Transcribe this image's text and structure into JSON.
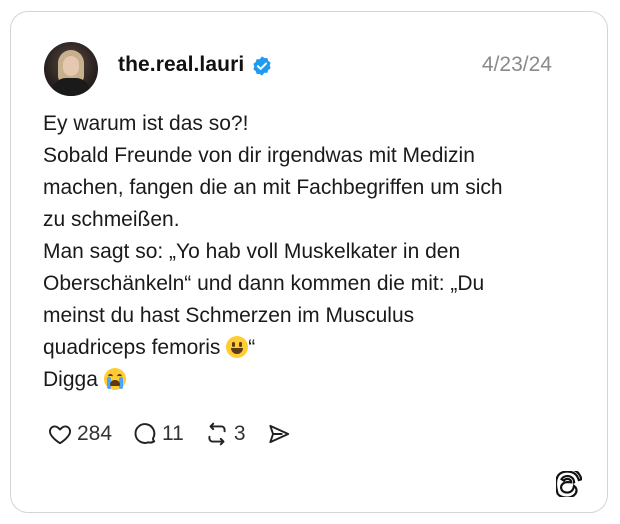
{
  "post": {
    "username": "the.real.lauri",
    "date": "4/23/24",
    "lines": [
      "Ey warum ist das so?!",
      "Sobald Freunde von dir irgendwas mit Medizin",
      "machen, fangen die an mit Fachbegriffen um sich",
      "zu schmeißen.",
      "Man sagt so: „Yo hab voll Muskelkater in den",
      "Oberschänkeln“ und dann kommen die mit: „Du",
      "meinst du hast Schmerzen im Musculus",
      "quadriceps femoris ",
      "Digga "
    ],
    "line7_suffix": "“"
  },
  "actions": {
    "likes": "284",
    "comments": "11",
    "reposts": "3"
  },
  "icons": {
    "verified": "verified-badge-icon",
    "like": "heart-icon",
    "comment": "comment-bubble-icon",
    "repost": "repost-icon",
    "share": "send-icon",
    "brand": "threads-logo-icon",
    "emoji_1": "grinning-face-emoji",
    "emoji_2": "loudly-crying-face-emoji"
  },
  "colors": {
    "verified": "#1d9bf0",
    "text": "#1a1a1a",
    "date": "#8a8a8a",
    "border": "#d4d4d4"
  }
}
